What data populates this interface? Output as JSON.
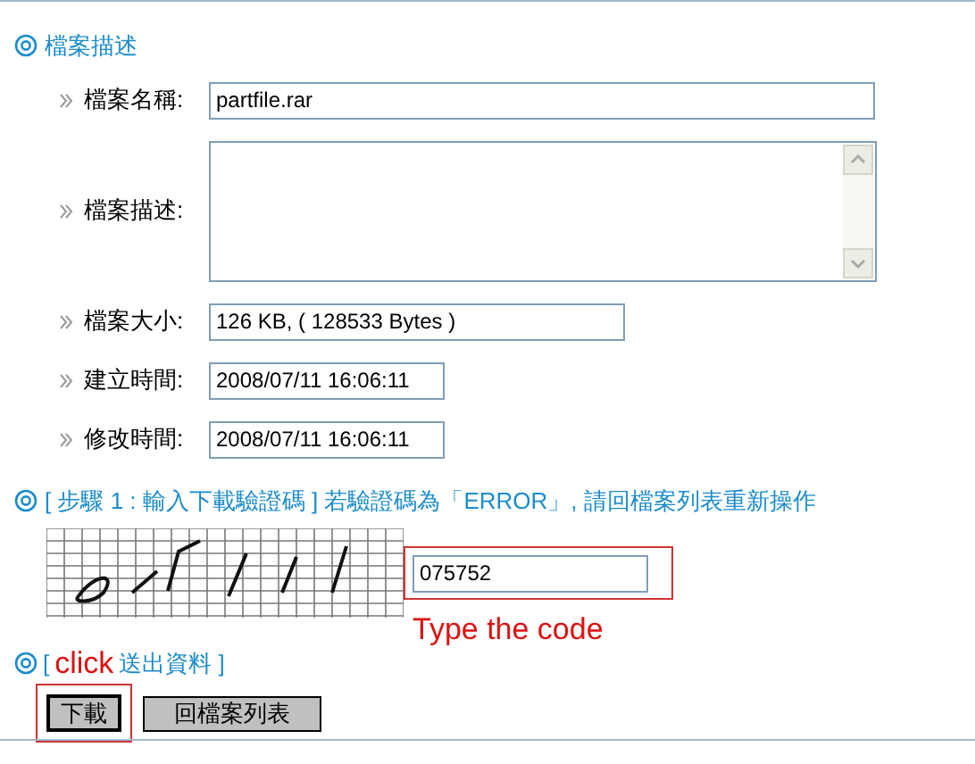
{
  "section_title": "檔案描述",
  "fields": [
    {
      "kind": "input",
      "label": "檔案名稱:",
      "value": "partfile.rar"
    },
    {
      "kind": "textarea",
      "label": "檔案描述:"
    },
    {
      "kind": "input",
      "label": "檔案大小:",
      "value": "126 KB, ( 128533 Bytes )"
    },
    {
      "kind": "input",
      "label": "建立時間:",
      "value": "2008/07/11 16:06:11"
    },
    {
      "kind": "input",
      "label": "修改時間:",
      "value": "2008/07/11 16:06:11"
    }
  ],
  "step1": "[ 步驟 1 : 輸入下載驗證碼 ] 若驗證碼為「ERROR」, 請回檔案列表重新操作",
  "code_field": {
    "value": "075752"
  },
  "type_hint": "Type the code",
  "step2": {
    "prefix": "[",
    "annotation": "click",
    "suffix": "送出資料 ]"
  },
  "buttons": [
    {
      "label": "下載",
      "highlighted": true
    },
    {
      "label": "回檔案列表",
      "highlighted": false
    }
  ]
}
